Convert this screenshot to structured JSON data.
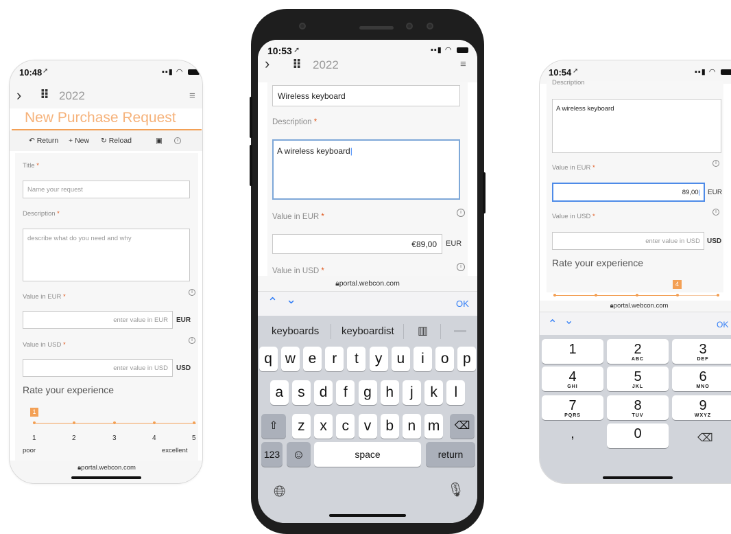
{
  "left_phone": {
    "time": "10:48",
    "year": "2022",
    "title": "New Purchase Request",
    "toolbar": {
      "return": "Return",
      "new": "New",
      "reload": "Reload"
    },
    "title_label": "Title",
    "title_placeholder": "Name your request",
    "description_label": "Description",
    "description_placeholder": "describe what do you need and why",
    "eur_label": "Value in EUR",
    "eur_placeholder": "enter value in EUR",
    "eur_unit": "EUR",
    "usd_label": "Value in USD",
    "usd_placeholder": "enter value in USD",
    "usd_unit": "USD",
    "rate_title": "Rate your experience",
    "rate_value": "1",
    "ticks": [
      "1",
      "2",
      "3",
      "4",
      "5"
    ],
    "low_label": "poor",
    "high_label": "excellent",
    "url": "portal.webcon.com"
  },
  "center_phone": {
    "time": "10:53",
    "year": "2022",
    "title_value": "Wireless keyboard",
    "description_label": "Description",
    "description_value": "A wireless keyboard",
    "eur_label": "Value in EUR",
    "eur_value": "€89,00",
    "eur_unit": "EUR",
    "usd_label": "Value in USD",
    "url": "portal.webcon.com",
    "ok": "OK",
    "suggestions": [
      "keyboards",
      "keyboardist"
    ],
    "rows": [
      [
        "q",
        "w",
        "e",
        "r",
        "t",
        "y",
        "u",
        "i",
        "o",
        "p"
      ],
      [
        "a",
        "s",
        "d",
        "f",
        "g",
        "h",
        "j",
        "k",
        "l"
      ],
      [
        "z",
        "x",
        "c",
        "v",
        "b",
        "n",
        "m"
      ]
    ],
    "numbers_key": "123",
    "space": "space",
    "return": "return"
  },
  "right_phone": {
    "time": "10:54",
    "description_label": "Description",
    "description_value": "A wireless keyboard",
    "eur_label": "Value in EUR",
    "eur_value": "89,00",
    "eur_unit": "EUR",
    "usd_label": "Value in USD",
    "usd_placeholder": "enter value in USD",
    "usd_unit": "USD",
    "rate_title": "Rate your experience",
    "rate_value": "4",
    "url": "portal.webcon.com",
    "ok": "OK",
    "numpad": [
      {
        "n": "1",
        "l": ""
      },
      {
        "n": "2",
        "l": "ABC"
      },
      {
        "n": "3",
        "l": "DEF"
      },
      {
        "n": "4",
        "l": "GHI"
      },
      {
        "n": "5",
        "l": "JKL"
      },
      {
        "n": "6",
        "l": "MNO"
      },
      {
        "n": "7",
        "l": "PQRS"
      },
      {
        "n": "8",
        "l": "TUV"
      },
      {
        "n": "9",
        "l": "WXYZ"
      },
      {
        "n": ",",
        "l": ""
      },
      {
        "n": "0",
        "l": ""
      }
    ]
  },
  "colors": {
    "accent": "#f3a055",
    "required": "#e0591f",
    "ios_blue": "#2f7cf6"
  }
}
